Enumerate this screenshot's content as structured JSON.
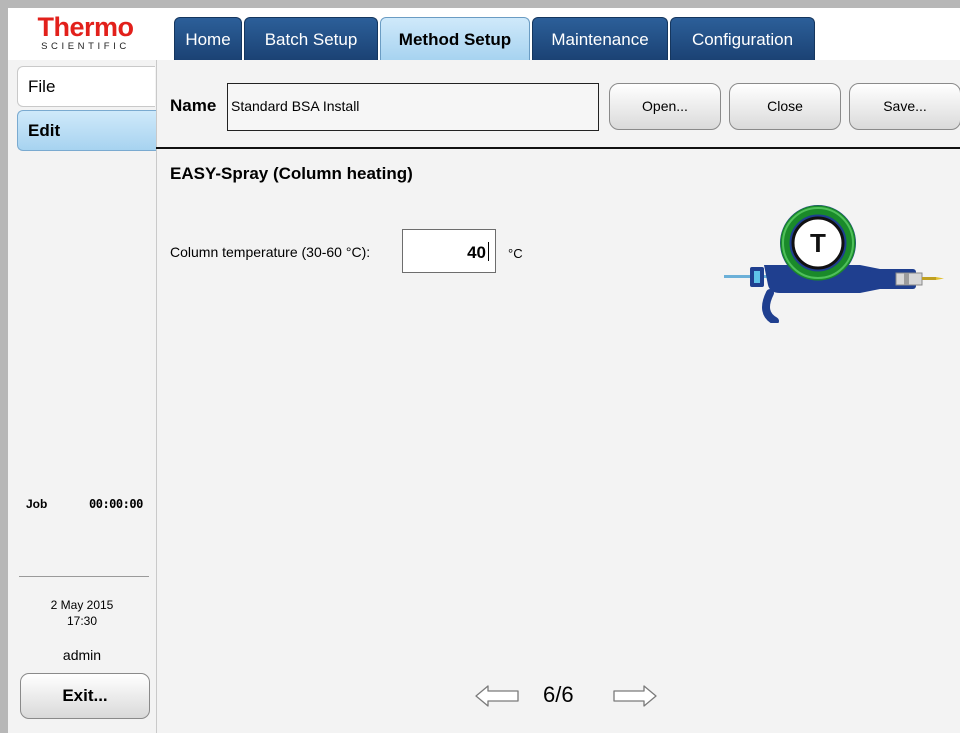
{
  "logo": {
    "brand": "Thermo",
    "sub": "SCIENTIFIC"
  },
  "tabs": [
    {
      "label": "Home"
    },
    {
      "label": "Batch Setup"
    },
    {
      "label": "Method Setup",
      "active": true
    },
    {
      "label": "Maintenance"
    },
    {
      "label": "Configuration"
    }
  ],
  "sidebar": {
    "file_label": "File",
    "edit_label": "Edit",
    "job_label": "Job",
    "job_time": "00:00:00",
    "date": "2 May 2015",
    "time": "17:30",
    "user": "admin",
    "exit_label": "Exit..."
  },
  "method": {
    "name_label": "Name",
    "name_value": "Standard BSA Install",
    "open_label": "Open...",
    "close_label": "Close",
    "save_label": "Save..."
  },
  "section": {
    "title": "EASY-Spray (Column heating)",
    "temp_label": "Column temperature (30-60 °C):",
    "temp_value": "40",
    "temp_unit": "°C",
    "illustration_letter": "T"
  },
  "pager": {
    "label": "6/6"
  },
  "colors": {
    "brand_red": "#e2201b",
    "tab_dark": "#1b4274",
    "tab_active": "#a7d3f0",
    "ring_green": "#1a8a2a",
    "column_blue": "#1f3f8f"
  }
}
